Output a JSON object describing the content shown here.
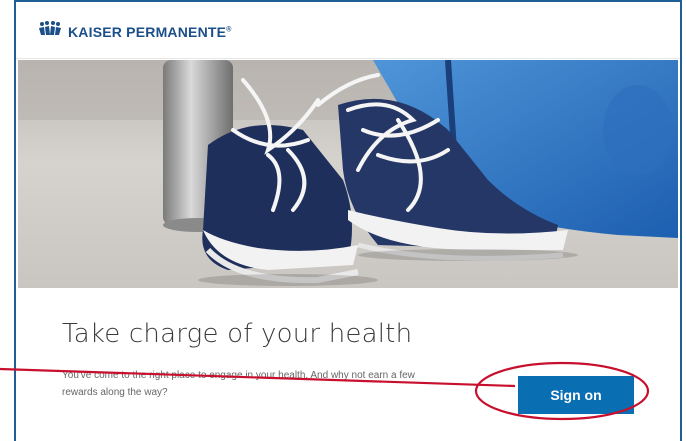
{
  "brand": {
    "name": "KAISER PERMANENTE",
    "mark": "®",
    "color": "#1b4f8a"
  },
  "hero": {
    "alt": "pair of sneakers in front of a gym bag and water bottle",
    "icon": "sneakers-image"
  },
  "main": {
    "title": "Take charge of your health",
    "body": "You've come to the right place to engage in your health. And why not earn a few rewards along the way?",
    "button_label": "Sign on"
  },
  "colors": {
    "accent": "#0a6eb3",
    "frame": "#1f5f95",
    "annotation": "#c8102e"
  }
}
